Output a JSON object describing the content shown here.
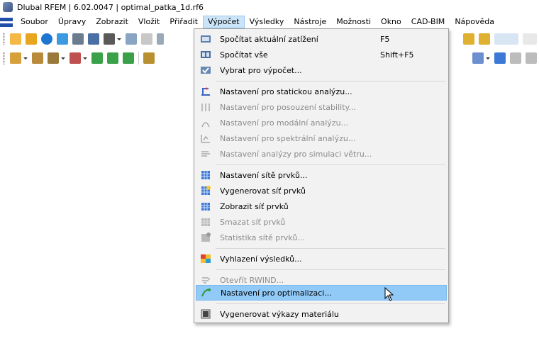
{
  "window": {
    "title": "Dlubal RFEM | 6.02.0047 | optimal_patka_1d.rf6"
  },
  "menubar": {
    "items": [
      {
        "label": "Soubor"
      },
      {
        "label": "Úpravy"
      },
      {
        "label": "Zobrazit"
      },
      {
        "label": "Vložit"
      },
      {
        "label": "Přiřadit"
      },
      {
        "label": "Výpočet"
      },
      {
        "label": "Výsledky"
      },
      {
        "label": "Nástroje"
      },
      {
        "label": "Možnosti"
      },
      {
        "label": "Okno"
      },
      {
        "label": "CAD-BIM"
      },
      {
        "label": "Nápověda"
      }
    ],
    "active": "Výpočet"
  },
  "menu": {
    "items": [
      {
        "label": "Spočítat aktuální zatížení",
        "shortcut": "F5",
        "icon": "calculate-current-icon",
        "enabled": true
      },
      {
        "label": "Spočítat vše",
        "shortcut": "Shift+F5",
        "icon": "calculate-all-icon",
        "enabled": true
      },
      {
        "label": "Vybrat pro výpočet...",
        "shortcut": "",
        "icon": "select-for-calc-icon",
        "enabled": true
      },
      {
        "label": "Nastavení pro statickou analýzu...",
        "shortcut": "",
        "icon": "static-analysis-icon",
        "enabled": true
      },
      {
        "label": "Nastavení pro posouzení stability...",
        "shortcut": "",
        "icon": "stability-analysis-icon",
        "enabled": false
      },
      {
        "label": "Nastavení pro modální analýzu...",
        "shortcut": "",
        "icon": "modal-analysis-icon",
        "enabled": false
      },
      {
        "label": "Nastavení pro spektrální analýzu...",
        "shortcut": "",
        "icon": "spectral-analysis-icon",
        "enabled": false
      },
      {
        "label": "Nastavení analýzy pro simulaci větru...",
        "shortcut": "",
        "icon": "wind-simulation-icon",
        "enabled": false
      },
      {
        "label": "Nastavení sítě prvků...",
        "shortcut": "",
        "icon": "mesh-settings-icon",
        "enabled": true
      },
      {
        "label": "Vygenerovat síť prvků",
        "shortcut": "",
        "icon": "generate-mesh-icon",
        "enabled": true
      },
      {
        "label": "Zobrazit síť prvků",
        "shortcut": "",
        "icon": "show-mesh-icon",
        "enabled": true
      },
      {
        "label": "Smazat síť prvků",
        "shortcut": "",
        "icon": "delete-mesh-icon",
        "enabled": false
      },
      {
        "label": "Statistika sítě prvků...",
        "shortcut": "",
        "icon": "mesh-statistics-icon",
        "enabled": false
      },
      {
        "label": "Vyhlazení výsledků...",
        "shortcut": "",
        "icon": "result-smoothing-icon",
        "enabled": true
      },
      {
        "label": "Otevřít RWIND...",
        "shortcut": "",
        "icon": "rwind-icon",
        "enabled": false
      },
      {
        "label": "Nastavení pro optimalizaci...",
        "shortcut": "",
        "icon": "optimization-icon",
        "enabled": true,
        "hovered": true
      },
      {
        "label": "Vygenerovat výkazy materiálu",
        "shortcut": "",
        "icon": "material-report-icon",
        "enabled": true
      }
    ]
  }
}
